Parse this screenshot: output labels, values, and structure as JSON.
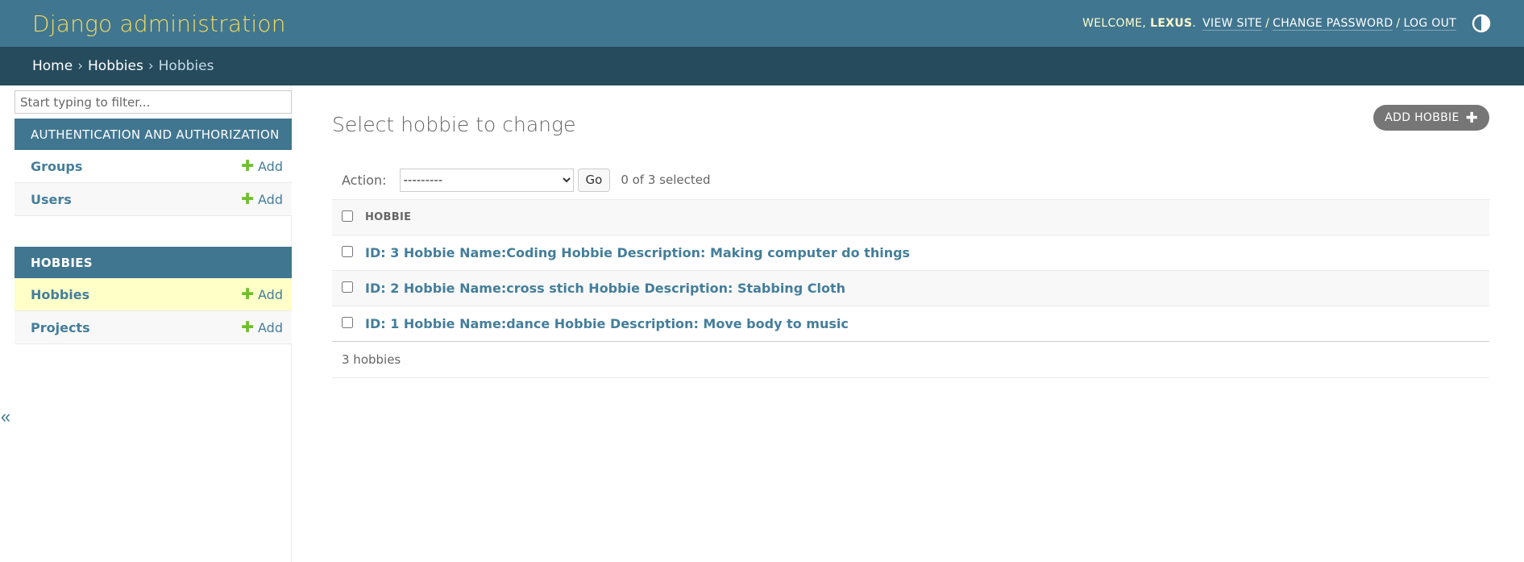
{
  "header": {
    "site_name": "Django administration",
    "welcome": "Welcome,",
    "username": "lexus",
    "after_username": ".",
    "view_site": "View site",
    "change_password": "Change password",
    "log_out": "Log out",
    "separator": "/"
  },
  "breadcrumbs": {
    "home": "Home",
    "app": "Hobbies",
    "current": "Hobbies",
    "sep": "›"
  },
  "sidebar": {
    "filter_placeholder": "Start typing to filter...",
    "add_label": "Add",
    "toggle_glyph": "«",
    "modules": [
      {
        "caption": "Authentication and Authorization",
        "items": [
          {
            "name": "Groups"
          },
          {
            "name": "Users"
          }
        ]
      },
      {
        "caption": "Hobbies",
        "items": [
          {
            "name": "Hobbies"
          },
          {
            "name": "Projects"
          }
        ]
      }
    ]
  },
  "content": {
    "title": "Select hobbie to change",
    "add_button": "Add hobbie",
    "action_label": "Action:",
    "action_selected": "---------",
    "go_label": "Go",
    "selected_count": "0 of 3 selected",
    "column_header": "Hobbie",
    "rows": [
      "ID: 3 Hobbie Name:Coding Hobbie Description: Making computer do things",
      "ID: 2 Hobbie Name:cross stich Hobbie Description: Stabbing Cloth",
      "ID: 1 Hobbie Name:dance Hobbie Description: Move body to music"
    ],
    "paginator": "3 hobbies"
  },
  "colors": {
    "header_bg": "#417690",
    "breadcrumbs_bg": "#264b5d",
    "site_name": "#f5dd5d",
    "link": "#447e9b",
    "add_plus": "#70bf2b",
    "current_row": "#ffffc8"
  },
  "icons": {
    "theme_toggle": "half-circle-contrast-icon",
    "add": "plus-icon",
    "collapse": "double-chevron-left-icon"
  }
}
